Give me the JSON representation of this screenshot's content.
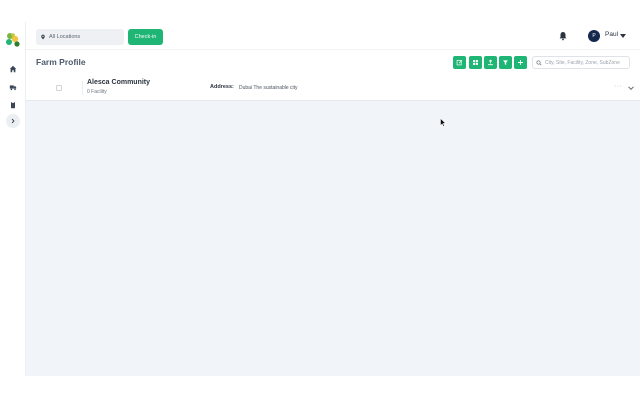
{
  "topbar": {
    "location_label": "All Locations",
    "checkin_label": "Check-in",
    "user": {
      "initial": "P",
      "name": "Paul"
    }
  },
  "header": {
    "title": "Farm Profile",
    "search_placeholder": "City, Site, Facility, Zone, SubZone"
  },
  "row": {
    "name": "Alesca Community",
    "subtitle": "0 Facility",
    "address_label": "Address:",
    "address_value": "Dubai The sustainable city",
    "more_label": "···"
  },
  "colors": {
    "accent": "#1fb574",
    "avatar": "#14294d",
    "content_bg": "#f1f4f8"
  }
}
